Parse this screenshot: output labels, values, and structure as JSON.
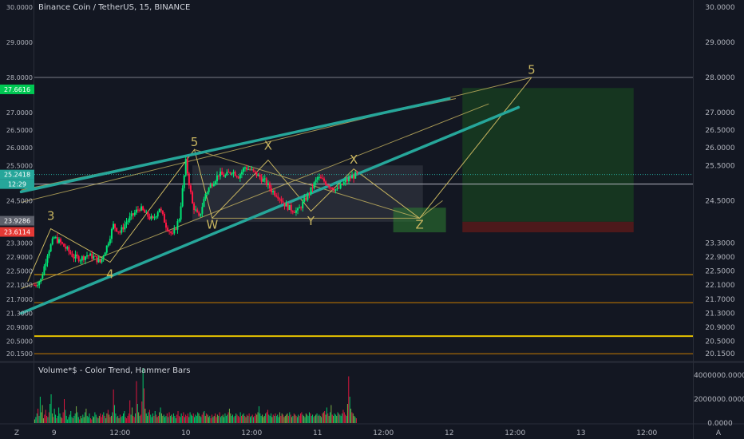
{
  "header": {
    "title": "Binance Coin / TetherUS, 15, BINANCE"
  },
  "volume_panel": {
    "title": "Volume*$ - Color Trend, Hammer Bars",
    "ticks": [
      {
        "label": "4000000.0000",
        "value": 4000000
      },
      {
        "label": "2000000.0000",
        "value": 2000000
      },
      {
        "label": "0.0000",
        "value": 0
      }
    ],
    "ymax": 5000000
  },
  "colors": {
    "background": "#131722",
    "up": "#26a69a",
    "up_bright": "#00e676",
    "down": "#ff1744",
    "trend": "#26a69a",
    "fib": "#c8b560",
    "support": "#f0a500",
    "target_zone": "#1b5e20",
    "stop_zone": "#5d1a1a",
    "text": "#b2b5be"
  },
  "chart_data": {
    "type": "candlestick",
    "title": "Binance Coin / TetherUS, 15, BINANCE",
    "xlabel": "",
    "ylabel": "",
    "ylim": [
      19.95,
      30.2
    ],
    "xlim": [
      0,
      100
    ],
    "y_ticks": [
      "30.0000",
      "29.0000",
      "28.0000",
      "27.0000",
      "26.5000",
      "26.0000",
      "25.5000",
      "24.5000",
      "23.3000",
      "22.9000",
      "22.5000",
      "22.1000",
      "21.7000",
      "21.3000",
      "20.9000",
      "20.5000",
      "20.1500"
    ],
    "price_labels": [
      {
        "value": 27.6616,
        "label": "27.6616",
        "color": "#00c853"
      },
      {
        "value": 25.2418,
        "label": "25.2418",
        "color": "#26a69a"
      },
      {
        "value": 24.97,
        "label": "12:29",
        "color": "#26a69a"
      },
      {
        "value": 23.9286,
        "label": "23.9286",
        "color": "#5d606b"
      },
      {
        "value": 23.6114,
        "label": "23.6114",
        "color": "#e53935"
      }
    ],
    "x_ticks": [
      {
        "label": "9",
        "x": 3
      },
      {
        "label": "12:00",
        "x": 13
      },
      {
        "label": "10",
        "x": 23
      },
      {
        "label": "12:00",
        "x": 33
      },
      {
        "label": "11",
        "x": 43
      },
      {
        "label": "12:00",
        "x": 53
      },
      {
        "label": "12",
        "x": 63
      },
      {
        "label": "12:00",
        "x": 73
      },
      {
        "label": "13",
        "x": 83
      },
      {
        "label": "12:00",
        "x": 93
      }
    ],
    "x_badge": "Z",
    "price_path": [
      {
        "x": 0,
        "y": 22.1
      },
      {
        "x": 1,
        "y": 22.25
      },
      {
        "x": 2,
        "y": 23.0
      },
      {
        "x": 3,
        "y": 23.45
      },
      {
        "x": 4,
        "y": 23.3
      },
      {
        "x": 5,
        "y": 23.1
      },
      {
        "x": 6,
        "y": 22.9
      },
      {
        "x": 7,
        "y": 22.85
      },
      {
        "x": 8,
        "y": 22.95
      },
      {
        "x": 9,
        "y": 22.9
      },
      {
        "x": 10,
        "y": 22.75
      },
      {
        "x": 11,
        "y": 23.2
      },
      {
        "x": 12,
        "y": 23.8
      },
      {
        "x": 13,
        "y": 23.6
      },
      {
        "x": 14,
        "y": 23.9
      },
      {
        "x": 15,
        "y": 24.1
      },
      {
        "x": 16,
        "y": 24.3
      },
      {
        "x": 17,
        "y": 24.1
      },
      {
        "x": 18,
        "y": 23.95
      },
      {
        "x": 19,
        "y": 24.3
      },
      {
        "x": 20,
        "y": 23.8
      },
      {
        "x": 21,
        "y": 23.5
      },
      {
        "x": 22,
        "y": 24.0
      },
      {
        "x": 23,
        "y": 25.6
      },
      {
        "x": 24,
        "y": 24.4
      },
      {
        "x": 25,
        "y": 24.0
      },
      {
        "x": 26,
        "y": 24.7
      },
      {
        "x": 27,
        "y": 25.0
      },
      {
        "x": 28,
        "y": 25.25
      },
      {
        "x": 29,
        "y": 25.2
      },
      {
        "x": 30,
        "y": 25.35
      },
      {
        "x": 31,
        "y": 25.2
      },
      {
        "x": 32,
        "y": 25.45
      },
      {
        "x": 33,
        "y": 25.35
      },
      {
        "x": 34,
        "y": 25.2
      },
      {
        "x": 35,
        "y": 25.05
      },
      {
        "x": 36,
        "y": 24.8
      },
      {
        "x": 37,
        "y": 24.65
      },
      {
        "x": 38,
        "y": 24.4
      },
      {
        "x": 39,
        "y": 24.25
      },
      {
        "x": 40,
        "y": 24.2
      },
      {
        "x": 41,
        "y": 24.5
      },
      {
        "x": 42,
        "y": 24.8
      },
      {
        "x": 43,
        "y": 25.15
      },
      {
        "x": 44,
        "y": 25.05
      },
      {
        "x": 45,
        "y": 24.9
      },
      {
        "x": 46,
        "y": 24.8
      },
      {
        "x": 47,
        "y": 25.0
      },
      {
        "x": 48,
        "y": 25.15
      },
      {
        "x": 49,
        "y": 25.25
      }
    ],
    "trend_lines": [
      {
        "x1": -2,
        "y1": 21.3,
        "x2": 73.5,
        "y2": 27.15
      },
      {
        "x1": -2,
        "y1": 24.75,
        "x2": 63,
        "y2": 27.4
      }
    ],
    "wave_path": [
      {
        "x": -1,
        "y": 22.2
      },
      {
        "x": 2.5,
        "y": 23.7
      },
      {
        "x": 11.5,
        "y": 22.75
      },
      {
        "x": 24.3,
        "y": 25.95
      },
      {
        "x": 27,
        "y": 24.0
      },
      {
        "x": 35.5,
        "y": 25.65
      },
      {
        "x": 42,
        "y": 24.2
      },
      {
        "x": 48.5,
        "y": 25.4
      },
      {
        "x": 58.5,
        "y": 24.0
      },
      {
        "x": 75.5,
        "y": 28.0
      }
    ],
    "fib_lines": [
      {
        "x1": -2,
        "y1": 24.45,
        "x2": 75.5,
        "y2": 28.0
      },
      {
        "x1": -2,
        "y1": 22.0,
        "x2": 69,
        "y2": 27.25
      },
      {
        "x1": -2,
        "y1": 24.8,
        "x2": 64,
        "y2": 27.4
      },
      {
        "x1": 24.3,
        "y1": 25.95,
        "x2": 58.5,
        "y2": 24.0
      },
      {
        "x1": 27,
        "y1": 24.0,
        "x2": 58.5,
        "y2": 24.0
      },
      {
        "x1": 58.5,
        "y1": 24.0,
        "x2": 62,
        "y2": 24.5
      }
    ],
    "labels": [
      {
        "text": "3",
        "x": 2.5,
        "y": 23.95
      },
      {
        "text": "4",
        "x": 11.5,
        "y": 22.3
      },
      {
        "text": "5",
        "x": 24.3,
        "y": 26.05
      },
      {
        "text": "X",
        "x": 35.5,
        "y": 25.95
      },
      {
        "text": "W",
        "x": 27,
        "y": 23.7
      },
      {
        "text": "Y",
        "x": 42,
        "y": 23.8
      },
      {
        "text": "X",
        "x": 48.5,
        "y": 25.55
      },
      {
        "text": "Z",
        "x": 58.5,
        "y": 23.7
      },
      {
        "text": "5",
        "x": 75.5,
        "y": 28.1
      }
    ],
    "horizontal_levels": [
      {
        "y": 28.0,
        "color": "#787b86",
        "width": 1
      },
      {
        "y": 24.97,
        "color": "#b2b5be",
        "width": 1
      },
      {
        "y": 22.4,
        "color": "#f0a500",
        "width": 1
      },
      {
        "y": 21.6,
        "color": "#c77c00",
        "width": 1
      },
      {
        "y": 20.65,
        "color": "#e6c200",
        "width": 2
      },
      {
        "y": 20.15,
        "color": "#c77c00",
        "width": 1
      }
    ],
    "consolidation_box": {
      "x1": 24,
      "x2": 59,
      "y1": 23.9,
      "y2": 25.5
    },
    "target_zone": {
      "x1": 65,
      "x2": 91,
      "y1": 23.9,
      "y2": 27.7
    },
    "stop_zone": {
      "x1": 65,
      "x2": 91,
      "y1": 23.6,
      "y2": 23.9
    },
    "entry_box": {
      "x1": 54.5,
      "x2": 62.5,
      "y1": 23.6,
      "y2": 24.3
    },
    "volume": [
      0.3,
      0.5,
      0.8,
      1.2,
      0.6,
      2.2,
      0.9,
      1.5,
      0.4,
      0.7,
      1.1,
      0.6,
      0.5,
      0.9,
      1.6,
      2.4,
      0.8,
      0.5,
      1.2,
      0.7,
      0.4,
      0.6,
      1.3,
      0.8,
      0.5,
      0.4,
      0.9,
      2.0,
      1.1,
      0.6,
      0.3,
      0.5,
      0.7,
      1.0,
      0.5,
      0.4,
      0.6,
      0.8,
      1.4,
      0.9,
      0.5,
      0.3,
      0.6,
      0.4,
      0.7,
      0.5,
      0.9,
      1.2,
      0.6,
      0.5,
      0.8,
      0.4,
      0.3,
      0.6,
      0.5,
      0.9,
      0.7,
      0.5,
      0.4,
      0.6,
      0.8,
      0.5,
      0.7,
      0.9,
      0.6,
      0.4,
      0.8,
      1.1,
      0.7,
      0.5,
      0.6,
      0.9,
      2.8,
      1.5,
      0.8,
      0.5,
      0.6,
      0.4,
      0.7,
      0.5,
      0.6,
      0.8,
      1.0,
      0.5,
      0.4,
      0.6,
      0.8,
      1.9,
      0.7,
      1.3,
      0.6,
      0.5,
      0.8,
      3.5,
      1.6,
      0.9,
      0.6,
      0.7,
      1.8,
      4.6,
      2.9,
      1.2,
      0.8,
      0.6,
      0.9,
      1.1,
      0.7,
      0.5,
      0.8,
      0.6,
      1.0,
      0.7,
      0.5,
      0.6,
      0.9,
      1.3,
      0.8,
      0.6,
      0.7,
      0.5,
      0.6,
      0.8,
      0.5,
      0.9,
      0.6,
      0.7,
      0.5,
      0.8,
      0.6,
      0.4,
      0.7,
      1.0,
      0.6,
      0.5,
      0.8,
      0.6,
      0.9,
      0.5,
      0.7,
      0.6,
      0.8,
      0.5,
      0.9,
      0.7,
      0.6,
      0.8,
      0.5,
      0.7,
      0.6,
      0.9,
      0.8,
      0.6,
      0.5,
      0.7,
      0.9,
      1.0,
      0.6,
      0.8,
      0.7,
      0.5,
      0.6,
      0.4,
      0.7,
      0.5,
      0.6,
      0.8,
      0.5,
      0.7,
      0.6,
      0.9,
      0.5,
      0.6,
      0.7,
      0.5,
      0.8,
      0.6,
      0.7,
      0.9,
      1.2,
      0.8,
      0.6,
      0.7,
      0.5,
      0.6,
      0.8,
      0.7,
      0.6,
      0.5,
      0.9,
      0.6,
      0.7,
      0.8,
      0.6,
      0.5,
      0.7,
      0.6,
      0.8,
      0.5,
      0.6,
      0.7,
      0.5,
      0.6,
      0.8,
      0.7,
      0.9,
      1.4,
      0.8,
      0.6,
      0.7,
      0.5,
      0.6,
      0.8,
      0.9,
      1.1,
      0.7,
      0.6,
      0.8,
      0.5,
      0.7,
      0.6,
      0.8,
      0.6,
      0.7,
      0.5,
      0.9,
      0.6,
      0.8,
      0.7,
      0.5,
      0.6,
      0.7,
      0.8,
      0.6,
      0.9,
      0.7,
      0.5,
      0.6,
      0.8,
      0.7,
      0.6,
      0.5,
      0.7,
      0.6,
      0.8,
      0.9,
      0.7,
      0.6,
      0.5,
      0.8,
      0.7,
      0.6,
      0.9,
      0.8,
      0.6,
      0.7,
      0.5,
      0.6,
      0.7,
      0.8,
      0.6,
      0.7,
      0.6,
      0.5,
      0.8,
      0.9,
      1.0,
      0.7,
      1.3,
      0.8,
      0.6,
      0.9,
      1.5,
      0.7,
      0.6,
      0.8,
      0.7,
      0.6,
      0.9,
      0.8,
      0.7,
      0.6,
      0.8,
      1.1,
      0.9,
      0.7,
      0.6,
      1.6,
      3.9,
      2.2,
      1.2,
      0.9,
      0.8,
      0.6,
      0.5,
      0.4
    ]
  }
}
